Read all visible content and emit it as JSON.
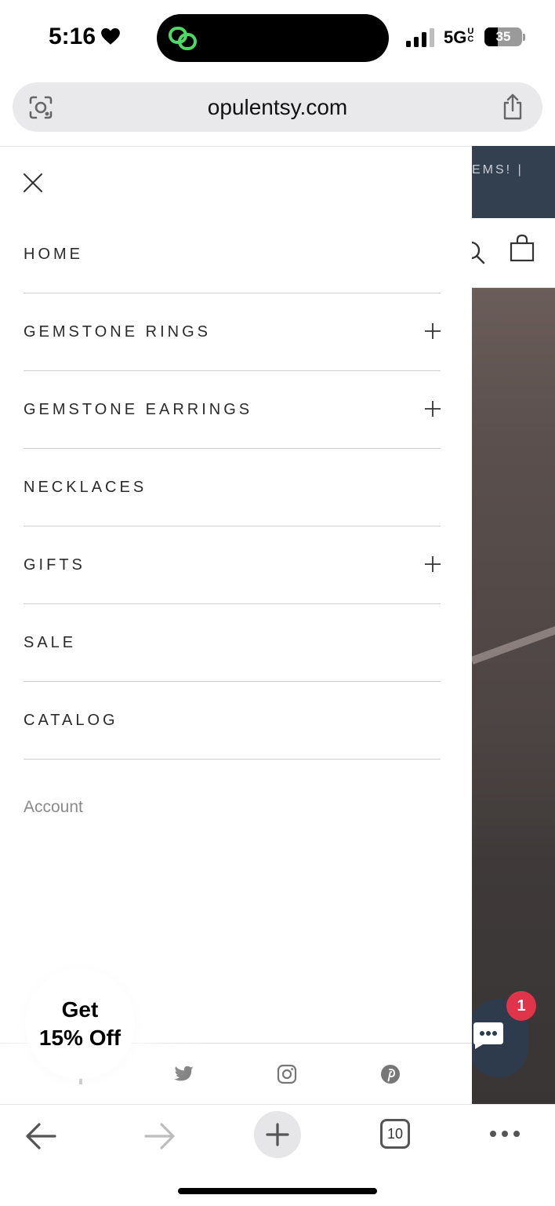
{
  "status_bar": {
    "time": "5:16",
    "network": "5G",
    "network_suffix": "UC",
    "battery": "35",
    "battery_level": 0.35
  },
  "browser": {
    "url": "opulentsy.com",
    "tab_count": "10"
  },
  "page_behind": {
    "announcement_fragment": "EMS! |",
    "chat_badge_count": "1"
  },
  "drawer": {
    "menu": [
      {
        "label": "HOME",
        "expandable": false
      },
      {
        "label": "GEMSTONE RINGS",
        "expandable": true
      },
      {
        "label": "GEMSTONE EARRINGS",
        "expandable": true
      },
      {
        "label": "NECKLACES",
        "expandable": false
      },
      {
        "label": "GIFTS",
        "expandable": true
      },
      {
        "label": "SALE",
        "expandable": false
      },
      {
        "label": "CATALOG",
        "expandable": false
      }
    ],
    "account_label": "Account",
    "social_icons": [
      "facebook-icon",
      "twitter-icon",
      "instagram-icon",
      "pinterest-icon"
    ]
  },
  "promo": {
    "line1": "Get",
    "line2": "15% Off"
  },
  "colors": {
    "announcement_bg": "#33404f",
    "chat_bubble": "#2e3b4d",
    "badge": "#e0344a",
    "island_icon": "#4cd964"
  }
}
